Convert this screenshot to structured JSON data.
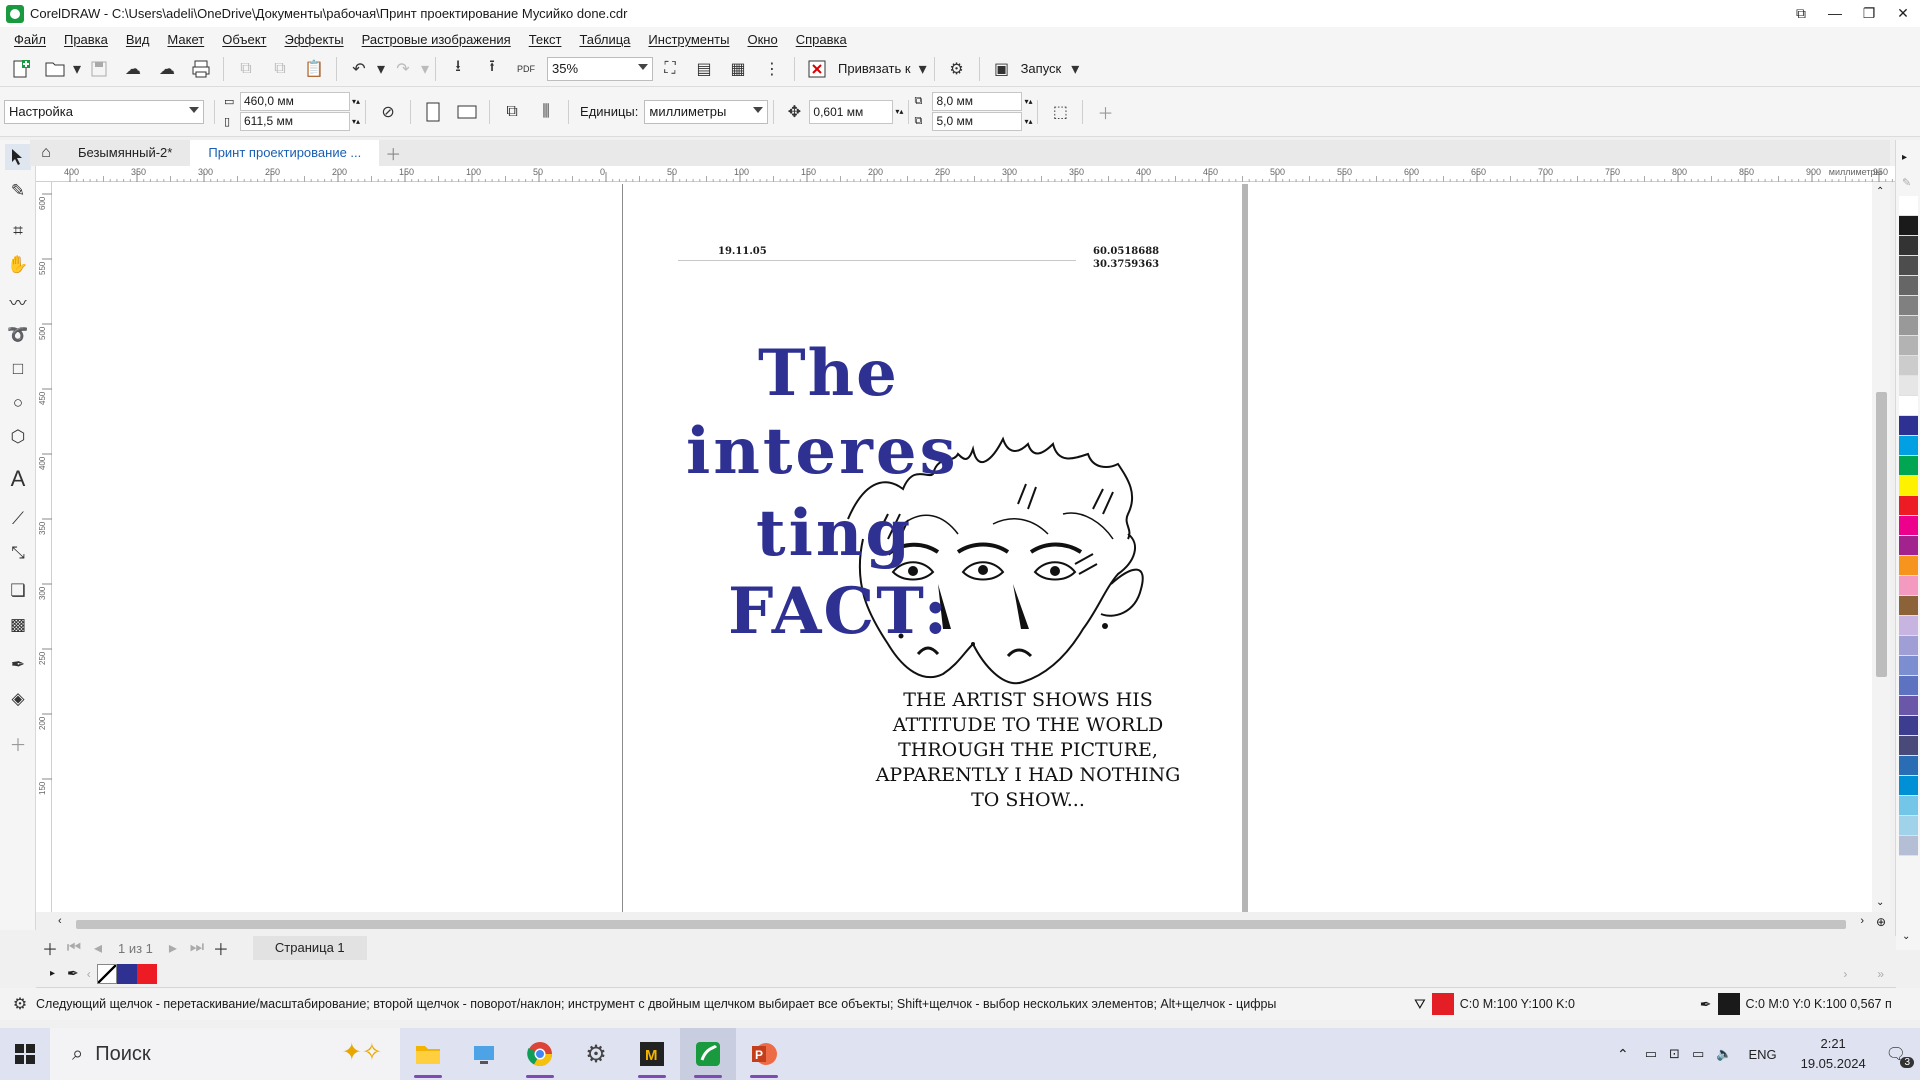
{
  "window": {
    "title": "CorelDRAW - C:\\Users\\adeli\\OneDrive\\Документы\\рабочая\\Принт проектирование Мусийко done.cdr"
  },
  "menu": [
    "Файл",
    "Правка",
    "Вид",
    "Макет",
    "Объект",
    "Эффекты",
    "Растровые изображения",
    "Текст",
    "Таблица",
    "Инструменты",
    "Окно",
    "Справка"
  ],
  "toolbar1": {
    "zoom": "35%",
    "snap_label": "Привязать к",
    "launch_label": "Запуск",
    "pdf_label": "PDF"
  },
  "toolbar2": {
    "preset": "Настройка",
    "width": "460,0 мм",
    "height": "611,5 мм",
    "units_label": "Единицы:",
    "units_value": "миллиметры",
    "nudge": "0,601 мм",
    "dup_x": "8,0 мм",
    "dup_y": "5,0 мм"
  },
  "tabs": [
    "Безымянный-2*",
    "Принт проектирование ..."
  ],
  "ruler": {
    "top_labels": [
      "400",
      "350",
      "300",
      "250",
      "200",
      "150",
      "100",
      "50",
      "0",
      "50",
      "100",
      "150",
      "200",
      "250",
      "300",
      "350",
      "400",
      "450",
      "500",
      "550",
      "600",
      "650",
      "700",
      "750",
      "800",
      "850",
      "900",
      "950"
    ],
    "left_labels": [
      "600",
      "550",
      "500",
      "450",
      "400",
      "350",
      "300",
      "250",
      "200",
      "150"
    ],
    "unit": "миллиметры"
  },
  "page_content": {
    "date": "19.11.05",
    "coords_line1": "60.0518688",
    "coords_line2": "30.3759363",
    "headline": [
      "The",
      "interes",
      "ting",
      "FACT:"
    ],
    "body": [
      "THE ARTIST SHOWS HIS",
      "ATTITUDE TO THE WORLD",
      "THROUGH THE PICTURE,",
      "APPARENTLY I HAD NOTHING",
      "TO SHOW..."
    ],
    "headline_color": "#2e3192"
  },
  "pagenav": {
    "page_of": "1  из  1",
    "page_tab": "Страница 1"
  },
  "status": {
    "hint": "Следующий щелчок - перетаскивание/масштабирование; второй щелчок - поворот/наклон; инструмент с двойным щелчком выбирает все объекты; Shift+щелчок - выбор нескольких элементов; Alt+щелчок - цифры",
    "fill_info": "C:0 M:100 Y:100 K:0",
    "outline_info": "C:0 M:0 Y:0 K:100  0,567 п",
    "fill_color": "#e31e24",
    "outline_color": "#1a1a1a"
  },
  "taskbar": {
    "search_placeholder": "Поиск",
    "lang": "ENG",
    "time": "2:21",
    "date": "19.05.2024",
    "notif_count": "3"
  },
  "palette_colors": [
    "#ffffff",
    "#1a1a1a",
    "#333333",
    "#4d4d4d",
    "#666666",
    "#808080",
    "#999999",
    "#b3b3b3",
    "#cccccc",
    "#e6e6e6",
    "#ffffff",
    "#2e3192",
    "#00a0e3",
    "#00a651",
    "#fff200",
    "#ed1c24",
    "#ec008c",
    "#a3238e",
    "#f7941d",
    "#f49ac1",
    "#8c6239",
    "#c7b4e0",
    "#9f9fd6",
    "#7c8ed0",
    "#5e72c2",
    "#6b57a8",
    "#3d3d8f",
    "#4a4a7a",
    "#2a6db5",
    "#0090d6",
    "#74c6e9",
    "#a0d2ea",
    "#b4bfd6"
  ],
  "doc_palette_colors": [
    "#2e3192",
    "#ed1c24"
  ]
}
